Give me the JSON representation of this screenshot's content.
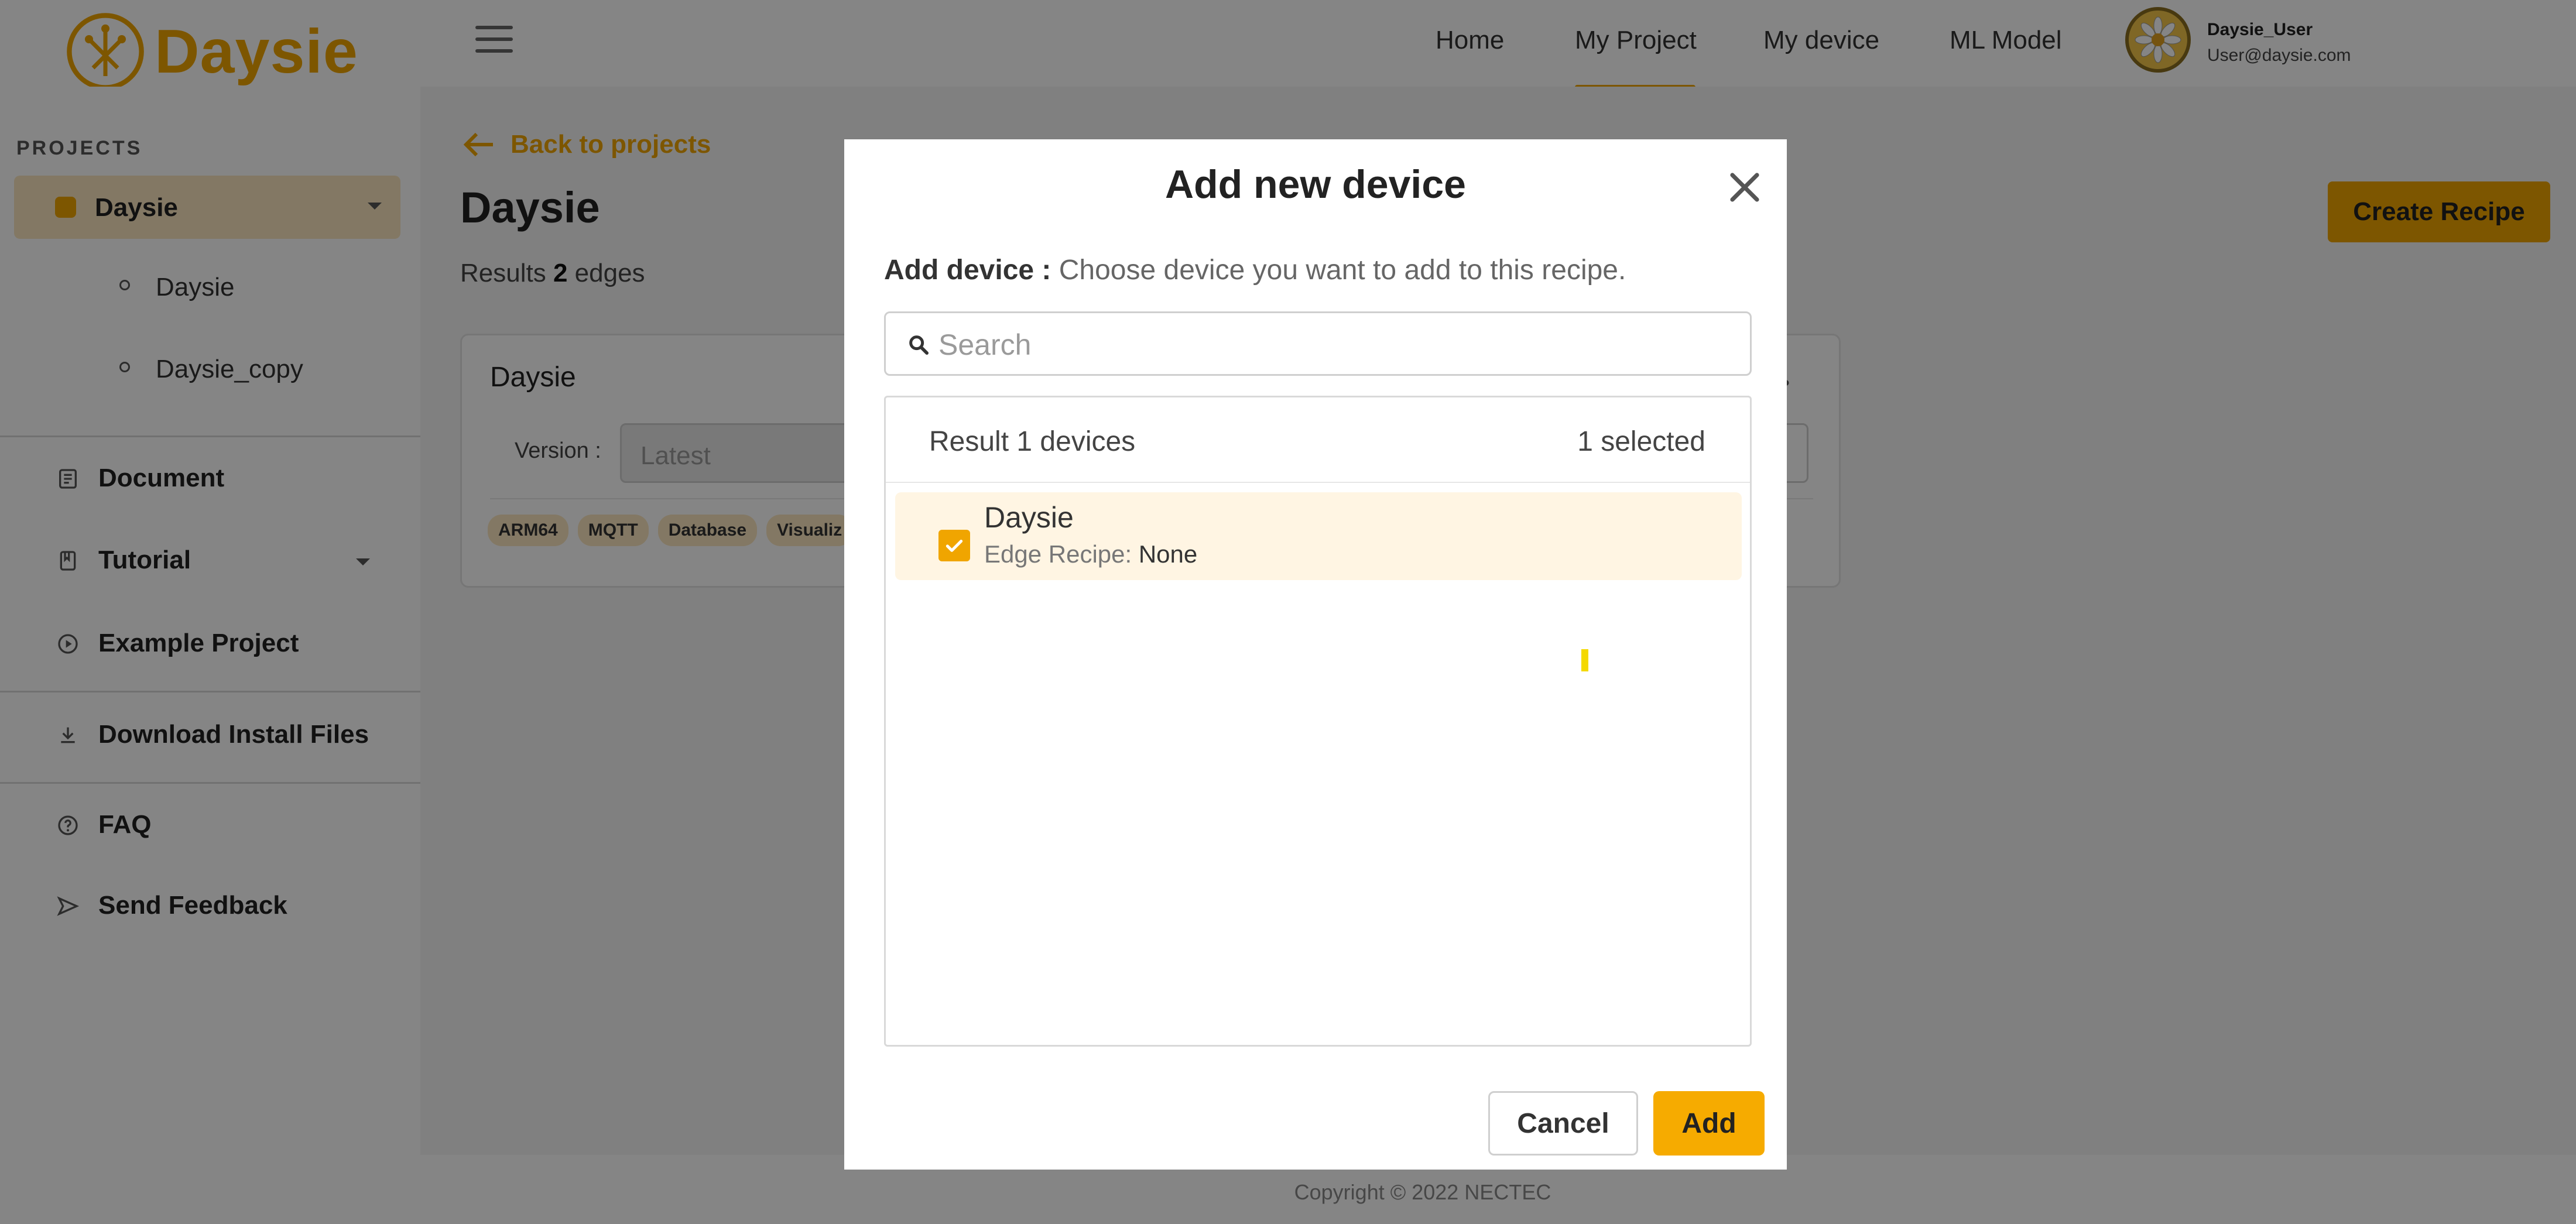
{
  "app": {
    "logo_text": "Daysie",
    "logo_icon": "daisy-circuit-icon"
  },
  "header": {
    "menu_icon": "hamburger-menu-icon",
    "nav": [
      {
        "label": "Home"
      },
      {
        "label": "My Project",
        "active": true
      },
      {
        "label": "My device"
      },
      {
        "label": "ML Model"
      }
    ],
    "user": {
      "name": "Daysie_User",
      "email": "User@daysie.com"
    }
  },
  "sidebar": {
    "heading": "PROJECTS",
    "project": {
      "label": "Daysie",
      "sub_items": [
        "Daysie",
        "Daysie_copy"
      ]
    },
    "items": [
      {
        "label": "Document",
        "icon": "document-icon"
      },
      {
        "label": "Tutorial",
        "icon": "book-icon"
      },
      {
        "label": "Example Project",
        "icon": "play-circle-icon"
      },
      {
        "label": "Download Install Files",
        "icon": "download-icon"
      },
      {
        "label": "FAQ",
        "icon": "help-circle-icon"
      },
      {
        "label": "Send Feedback",
        "icon": "send-icon"
      }
    ]
  },
  "main": {
    "back_label": "Back to projects",
    "title": "Daysie",
    "results_prefix": "Results",
    "results_count": "2",
    "results_suffix": "edges",
    "create_button": "Create Recipe",
    "card": {
      "title": "Daysie",
      "version_label": "Version :",
      "version_value": "Latest",
      "tags": [
        "ARM64",
        "MQTT",
        "Database",
        "Visualiz"
      ]
    }
  },
  "footer": {
    "copyright": "Copyright © 2022 NECTEC"
  },
  "modal": {
    "title": "Add new device",
    "desc_label": "Add device :",
    "desc_text": "Choose device you want to add to this recipe.",
    "search_placeholder": "Search",
    "result_text": "Result 1 devices",
    "selected_text": "1 selected",
    "devices": [
      {
        "name": "Daysie",
        "recipe_label": "Edge Recipe:",
        "recipe_value": "None",
        "checked": true
      }
    ],
    "cancel_button": "Cancel",
    "add_button": "Add"
  },
  "colors": {
    "accent": "#f0a500",
    "overlay": "rgba(0,0,0,0.48)",
    "row_highlight": "#fff5e3"
  }
}
